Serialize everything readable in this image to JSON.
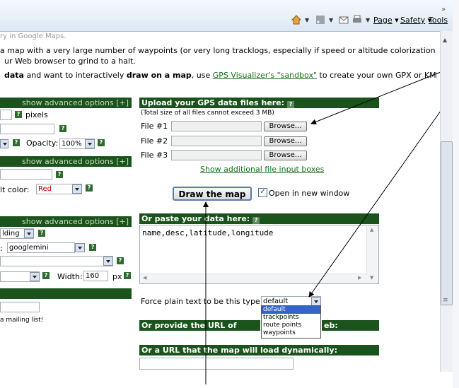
{
  "toolbar": {
    "page_label": "Page",
    "safety_label": "Safety",
    "tools_label": "Tools",
    "overflow": "»"
  },
  "intro": {
    "line0": "ry in Google Maps.",
    "line1": " a map with a very large number of waypoints (or very long tracklogs, especially if speed or altitude colorization",
    "line2": "ur Web browser to grind to a halt.",
    "line3_a": "data",
    "line3_b": " and want to interactively ",
    "line3_c": "draw on a map",
    "line3_d": ", use ",
    "line3_link": "GPS Visualizer's \"sandbox\"",
    "line3_e": " to create your own GPX or KML"
  },
  "left": {
    "adv1": "show advanced options [+]",
    "pixels": "pixels",
    "opacity_label": "Opacity:",
    "opacity_value": "100%",
    "adv2": "show advanced options [+]",
    "color_label": "lt color:",
    "color_value": "Red",
    "adv3": "show advanced options [+]",
    "shading_value": "lding",
    "map_prefix": ":",
    "map_value": "googlemini",
    "width_label": "Width:",
    "width_value": "160",
    "px_label": "px",
    "mailing": "a mailing list!"
  },
  "upload": {
    "header": "Upload your GPS data files here:",
    "note": "(Total size of all files cannot exceed 3 MB)",
    "file1": "File #1",
    "file2": "File #2",
    "file3": "File #3",
    "browse": "Browse...",
    "more_link": "Show additional file input boxes"
  },
  "draw": {
    "button": "Draw the map",
    "new_window": "Open in new window",
    "new_window_checked": true
  },
  "paste": {
    "header": "Or paste your data here:",
    "content": "name,desc,latitude,longitude",
    "force_label": "Force plain text to be this type:",
    "type_value": "default",
    "type_options": [
      "default",
      "trackpoints",
      "route points",
      "waypoints"
    ]
  },
  "url1": {
    "header_a": "Or provide the URL of static",
    "header_b": "eb:"
  },
  "url2": {
    "header": "Or a URL that the map will load dynamically:"
  },
  "colors": {
    "header_bg": "#1a531b",
    "link": "#1a6d1a",
    "select_highlight": "#3066c8"
  }
}
